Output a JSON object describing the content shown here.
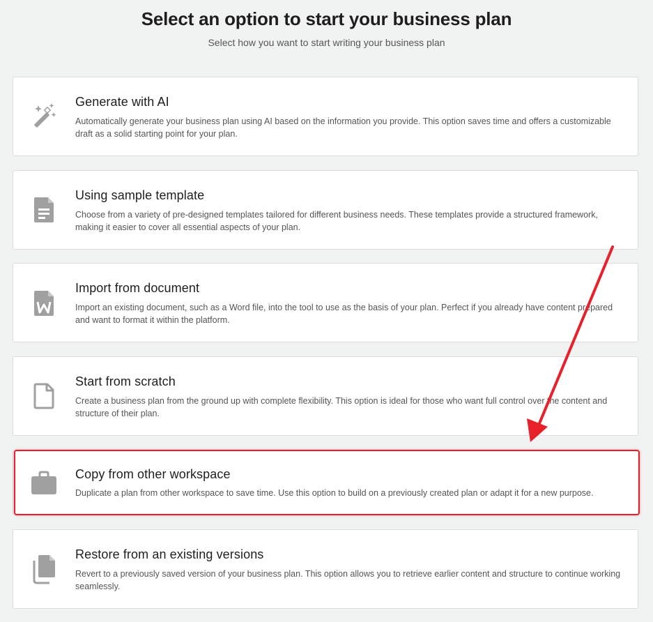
{
  "header": {
    "title": "Select an option to start your business plan",
    "subtitle": "Select how you want to start writing your business plan"
  },
  "options": [
    {
      "title": "Generate with AI",
      "description": "Automatically generate your business plan using AI based on the information you provide. This option saves time and offers a customizable draft as a solid starting point for your plan.",
      "icon": "magic-wand-icon"
    },
    {
      "title": "Using sample template",
      "description": "Choose from a variety of pre-designed templates tailored for different business needs. These templates provide a structured framework, making it easier to cover all essential aspects of your plan.",
      "icon": "document-template-icon"
    },
    {
      "title": "Import from document",
      "description": "Import an existing document, such as a Word file, into the tool to use as the basis of your plan. Perfect if you already have content prepared and want to format it within the platform.",
      "icon": "word-document-icon"
    },
    {
      "title": "Start from scratch",
      "description": "Create a business plan from the ground up with complete flexibility. This option is ideal for those who want full control over the content and structure of their plan.",
      "icon": "blank-file-icon"
    },
    {
      "title": "Copy from other workspace",
      "description": "Duplicate a plan from other workspace to save time. Use this option to build on a previously created plan or adapt it for a new purpose.",
      "icon": "briefcase-icon"
    },
    {
      "title": "Restore from an existing versions",
      "description": "Revert to a previously saved version of your business plan. This option allows you to retrieve earlier content and structure to continue working seamlessly.",
      "icon": "copy-files-icon"
    }
  ],
  "annotation": {
    "highlight_color": "#e8202a",
    "highlighted_option": "Copy from other workspace"
  },
  "colors": {
    "icon": "#a0a0a0",
    "background": "#f1f2f2",
    "card": "#ffffff"
  }
}
